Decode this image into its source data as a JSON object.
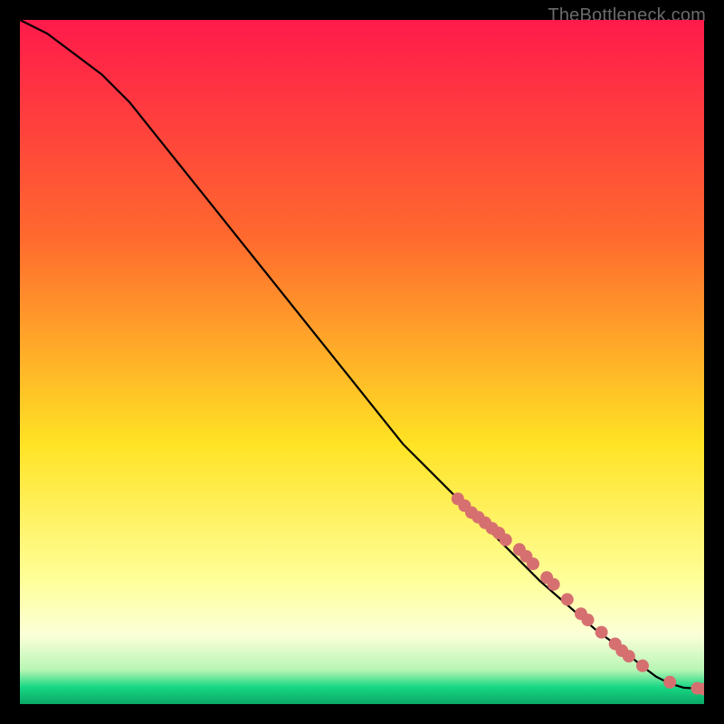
{
  "watermark": "TheBottleneck.com",
  "colors": {
    "marker": "#d67070",
    "line": "#000000",
    "red": "#ff1a4b",
    "orange": "#ff8a2a",
    "yellow": "#ffe324",
    "paleYellow": "#ffffc7",
    "green": "#18d884",
    "black": "#000000"
  },
  "chart_data": {
    "type": "line",
    "title": "",
    "xlabel": "",
    "ylabel": "",
    "xlim": [
      0,
      100
    ],
    "ylim": [
      0,
      100
    ],
    "grid": false,
    "note": "Axes and gridlines are hidden. x is normalized position along the horizontal axis (0=left, 100=right) and y is normalized height above the bottom baseline (0=bottom). Values estimated from pixel positions.",
    "series": [
      {
        "name": "curve",
        "kind": "line",
        "x": [
          0,
          4,
          8,
          12,
          16,
          20,
          24,
          28,
          32,
          36,
          40,
          44,
          48,
          52,
          56,
          60,
          64,
          68,
          72,
          76,
          80,
          84,
          88,
          91,
          93,
          95,
          97,
          100
        ],
        "y": [
          100,
          98,
          95,
          92,
          88,
          83,
          78,
          73,
          68,
          63,
          58,
          53,
          48,
          43,
          38,
          34,
          30,
          26,
          22,
          18,
          14.5,
          11,
          8,
          5.5,
          4,
          3,
          2.4,
          2.2
        ]
      },
      {
        "name": "markers",
        "kind": "scatter",
        "x": [
          64,
          65,
          66,
          67,
          68,
          69,
          70,
          71,
          73,
          74,
          75,
          77,
          78,
          80,
          82,
          83,
          85,
          87,
          88,
          89,
          91,
          95,
          99,
          100
        ],
        "y": [
          30,
          29,
          28,
          27.3,
          26.5,
          25.7,
          25,
          24,
          22.6,
          21.6,
          20.5,
          18.5,
          17.5,
          15.3,
          13.2,
          12.3,
          10.5,
          8.8,
          7.8,
          7,
          5.6,
          3.2,
          2.3,
          2.2
        ]
      }
    ]
  }
}
